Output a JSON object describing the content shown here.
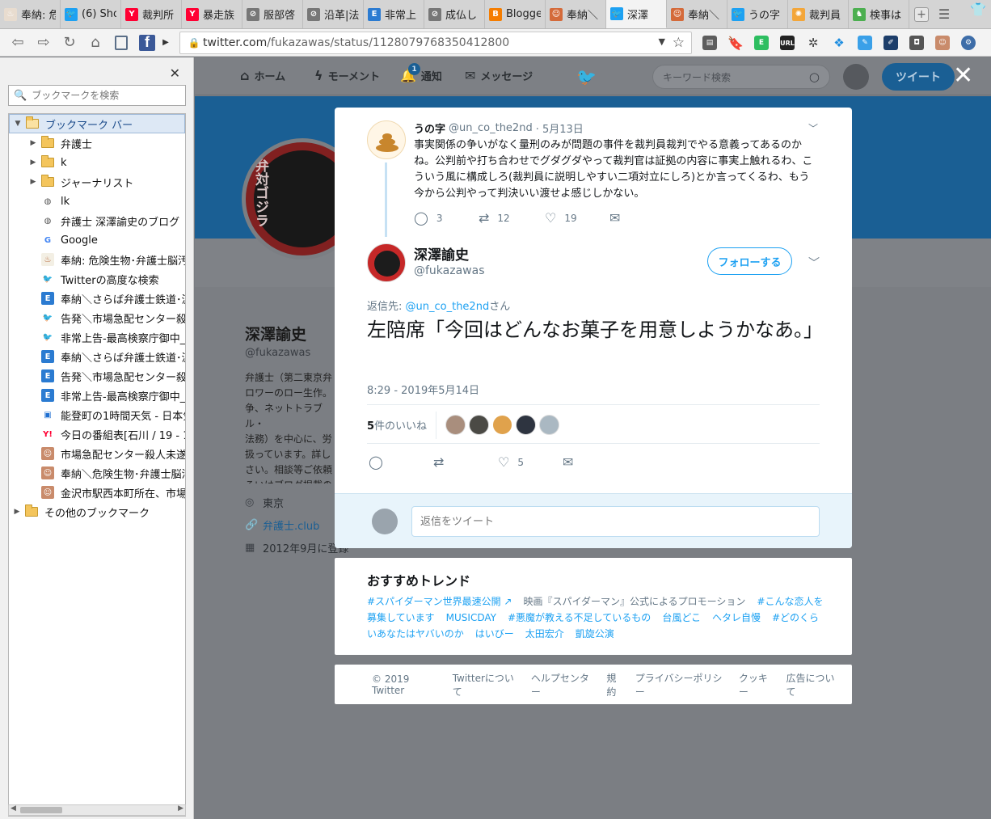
{
  "browser": {
    "tabs": [
      {
        "label": "奉納: 危",
        "color": "#e8dccf",
        "glyph": "♨"
      },
      {
        "label": "(6) Sho",
        "color": "#1da1f2",
        "glyph": "🐦"
      },
      {
        "label": "裁判所",
        "color": "#ff0033",
        "glyph": "Y"
      },
      {
        "label": "暴走族",
        "color": "#ff0033",
        "glyph": "Y"
      },
      {
        "label": "服部啓",
        "color": "#777777",
        "glyph": "⊘"
      },
      {
        "label": "沿革|法",
        "color": "#777777",
        "glyph": "⊘"
      },
      {
        "label": "非常上",
        "color": "#2b7bd1",
        "glyph": "E"
      },
      {
        "label": "成仏し",
        "color": "#777777",
        "glyph": "⊘"
      },
      {
        "label": "Blogge",
        "color": "#f57d00",
        "glyph": "B"
      },
      {
        "label": "奉納＼",
        "color": "#d46a3a",
        "glyph": "☺"
      },
      {
        "label": "深澤",
        "color": "#1da1f2",
        "glyph": "🐦",
        "active": true
      },
      {
        "label": "奉納＼",
        "color": "#d46a3a",
        "glyph": "☺"
      },
      {
        "label": "うの字",
        "color": "#1da1f2",
        "glyph": "🐦"
      },
      {
        "label": "裁判員",
        "color": "#f3a63a",
        "glyph": "✺"
      },
      {
        "label": "検事は",
        "color": "#4caf50",
        "glyph": "♞"
      }
    ],
    "url_host": "twitter.com",
    "url_path": "/fukazawas/status/1128079768350412800"
  },
  "sidebar": {
    "search_placeholder": "ブックマークを検索",
    "bookmark_bar": "ブックマーク バー",
    "items": [
      {
        "label": "弁護士",
        "type": "folder"
      },
      {
        "label": "k",
        "type": "folder"
      },
      {
        "label": "ジャーナリスト",
        "type": "folder"
      },
      {
        "label": "lk",
        "type": "globe"
      },
      {
        "label": "弁護士 深澤諭史のブログ",
        "type": "globe"
      },
      {
        "label": "Google",
        "type": "google"
      },
      {
        "label": "奉納: 危険生物･弁護士脳汚",
        "type": "sticker"
      },
      {
        "label": "Twitterの高度な検索",
        "type": "twitter"
      },
      {
        "label": "奉納＼さらば弁護士鉄道･泥",
        "type": "e"
      },
      {
        "label": "告発＼市場急配センター殺人",
        "type": "twitter"
      },
      {
        "label": "非常上告-最高検察庁御中_",
        "type": "twitter"
      },
      {
        "label": "奉納＼さらば弁護士鉄道･泥",
        "type": "e"
      },
      {
        "label": "告発＼市場急配センター殺人",
        "type": "e"
      },
      {
        "label": "非常上告-最高検察庁御中_",
        "type": "e"
      },
      {
        "label": "能登町の1時間天気 - 日本気",
        "type": "cube"
      },
      {
        "label": "今日の番組表[石川 / 19 - 1月",
        "type": "yahoo"
      },
      {
        "label": "市場急配センター殺人未遂事",
        "type": "photo"
      },
      {
        "label": "奉納＼危険生物･弁護士脳汚",
        "type": "photo"
      },
      {
        "label": "金沢市駅西本町所在、市場急",
        "type": "photo"
      }
    ],
    "other_bookmarks": "その他のブックマーク"
  },
  "twitter_nav": {
    "home": "ホーム",
    "moments": "モーメント",
    "notifications": "通知",
    "notifications_badge": "1",
    "messages": "メッセージ",
    "search_placeholder": "キーワード検索",
    "tweet_button": "ツイート"
  },
  "profile": {
    "name": "深澤諭史",
    "handle": "@fukazawas",
    "bio": "弁護士（第二東京弁\nロワーのロー生作。\n争、ネットトラブル・\n法務）を中心に、労\n扱っています。詳し\nさい。相談等ご依頼\nるいはブログ掲載の",
    "location": "東京",
    "website": "弁護士.club",
    "joined": "2012年9月に登録",
    "avatar_text": "弁対ゴジラ"
  },
  "parent_tweet": {
    "name": "うの字",
    "handle": "@un_co_the2nd",
    "date": "· 5月13日",
    "text": "事実関係の争いがなく量刑のみが問題の事件を裁判員裁判でやる意義ってあるのかね。公判前や打ち合わせでグダグダやって裁判官は証拠の内容に事実上触れるわ、こういう風に構成しろ(裁判員に説明しやすい二項対立にしろ)とか言ってくるわ、もう今から公判やって判決いい渡せよ感じしかない。",
    "replies": "3",
    "retweets": "12",
    "likes": "19"
  },
  "main_tweet": {
    "name": "深澤諭史",
    "handle": "@fukazawas",
    "follow_button": "フォローする",
    "reply_to_prefix": "返信先: ",
    "reply_to_mention": "@un_co_the2nd",
    "reply_to_suffix": "さん",
    "text": "左陪席「今回はどんなお菓子を用意しようかなあ。」",
    "timestamp": "8:29 - 2019年5月14日",
    "like_count": "5",
    "like_count_label": "件のいいね",
    "likes_action": "5",
    "reply_placeholder": "返信をツイート"
  },
  "trends": {
    "title": "おすすめトレンド",
    "items": [
      {
        "text": "#スパイダーマン世界最速公開 ↗"
      },
      {
        "text": "映画『スパイダーマン』公式によるプロモーション",
        "promo": true
      },
      {
        "text": "#こんな恋人を募集しています"
      },
      {
        "text": "MUSICDAY"
      },
      {
        "text": "#悪魔が教える不足しているもの"
      },
      {
        "text": "台風どこ"
      },
      {
        "text": "ヘタレ自慢"
      },
      {
        "text": "#どのくらいあなたはヤバいのか"
      },
      {
        "text": "はいびー"
      },
      {
        "text": "太田宏介"
      },
      {
        "text": "凱旋公演"
      }
    ]
  },
  "footer": {
    "items": [
      "© 2019 Twitter",
      "Twitterについて",
      "ヘルプセンター",
      "規約",
      "プライバシーポリシー",
      "クッキー",
      "広告について"
    ]
  }
}
